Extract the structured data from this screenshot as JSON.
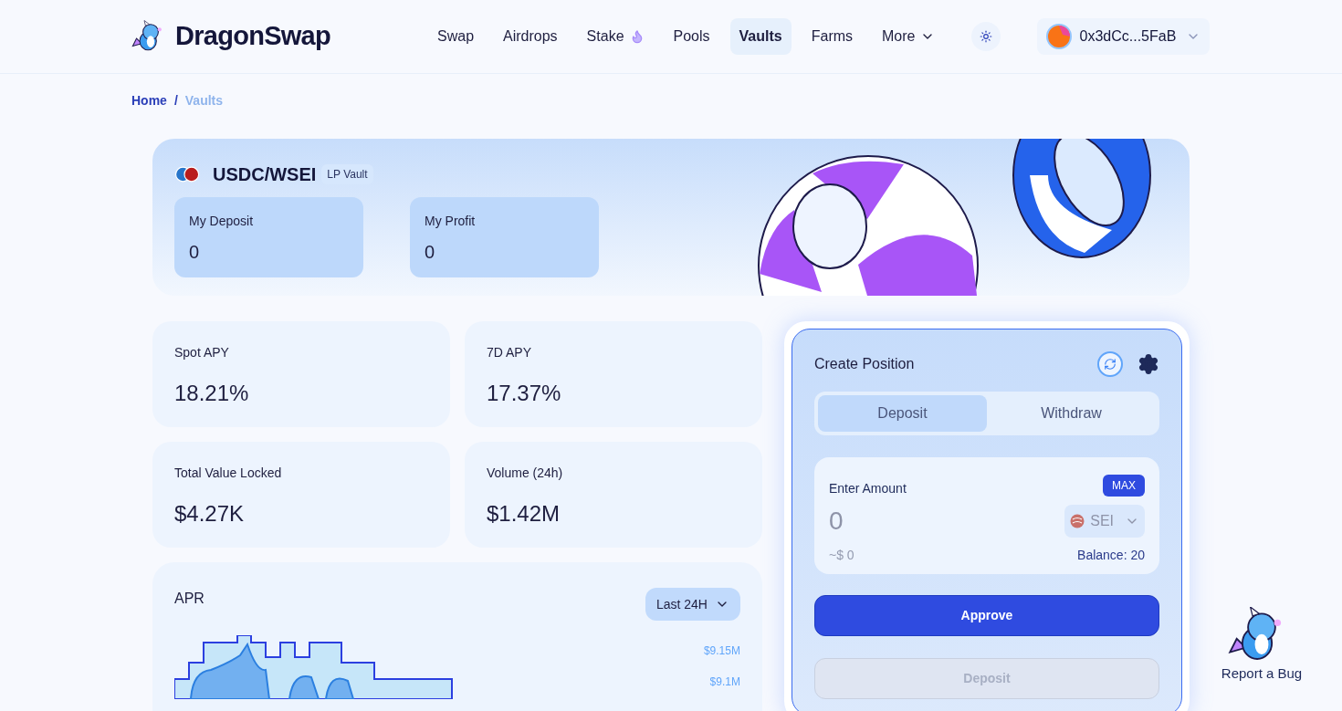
{
  "header": {
    "logo_text": "DragonSwap",
    "nav": [
      {
        "label": "Swap",
        "selected": false,
        "kind": "link"
      },
      {
        "label": "Airdrops",
        "selected": false,
        "kind": "link"
      },
      {
        "label": "Stake",
        "selected": false,
        "kind": "flame"
      },
      {
        "label": "Pools",
        "selected": false,
        "kind": "link"
      },
      {
        "label": "Vaults",
        "selected": true,
        "kind": "link"
      },
      {
        "label": "Farms",
        "selected": false,
        "kind": "link"
      },
      {
        "label": "More",
        "selected": false,
        "kind": "menu"
      }
    ],
    "wallet": "0x3dCc...5FaB"
  },
  "breadcrumb_separator": "/",
  "breadcrumb": [
    {
      "label": "Home",
      "selected": false
    },
    {
      "label": "Vaults",
      "selected": true
    }
  ],
  "vault": {
    "pair": "USDC/WSEI",
    "badge": "LP Vault",
    "summary": [
      {
        "label": "My Deposit",
        "value": "0"
      },
      {
        "label": "My Profit",
        "value": "0"
      }
    ]
  },
  "stats": [
    {
      "label": "Spot APY",
      "value": "18.21%"
    },
    {
      "label": "7D APY",
      "value": "17.37%"
    },
    {
      "label": "Total Value Locked",
      "value": "$4.27K"
    },
    {
      "label": "Volume (24h)",
      "value": "$1.42M"
    }
  ],
  "apr": {
    "title": "APR",
    "range": "Last 24H",
    "axis_labels": [
      "$9.15M",
      "$9.1M"
    ]
  },
  "position": {
    "title": "Create Position",
    "tabs": [
      {
        "label": "Deposit",
        "selected": true
      },
      {
        "label": "Withdraw",
        "selected": false
      }
    ],
    "amount_label": "Enter Amount",
    "max": "MAX",
    "placeholder": "0",
    "token": "SEI",
    "usd": "~$ 0",
    "balance": "Balance: 20",
    "buttons": [
      {
        "label": "Approve",
        "disabled": false
      },
      {
        "label": "Deposit",
        "disabled": true
      }
    ]
  },
  "report": "Report a Bug"
}
